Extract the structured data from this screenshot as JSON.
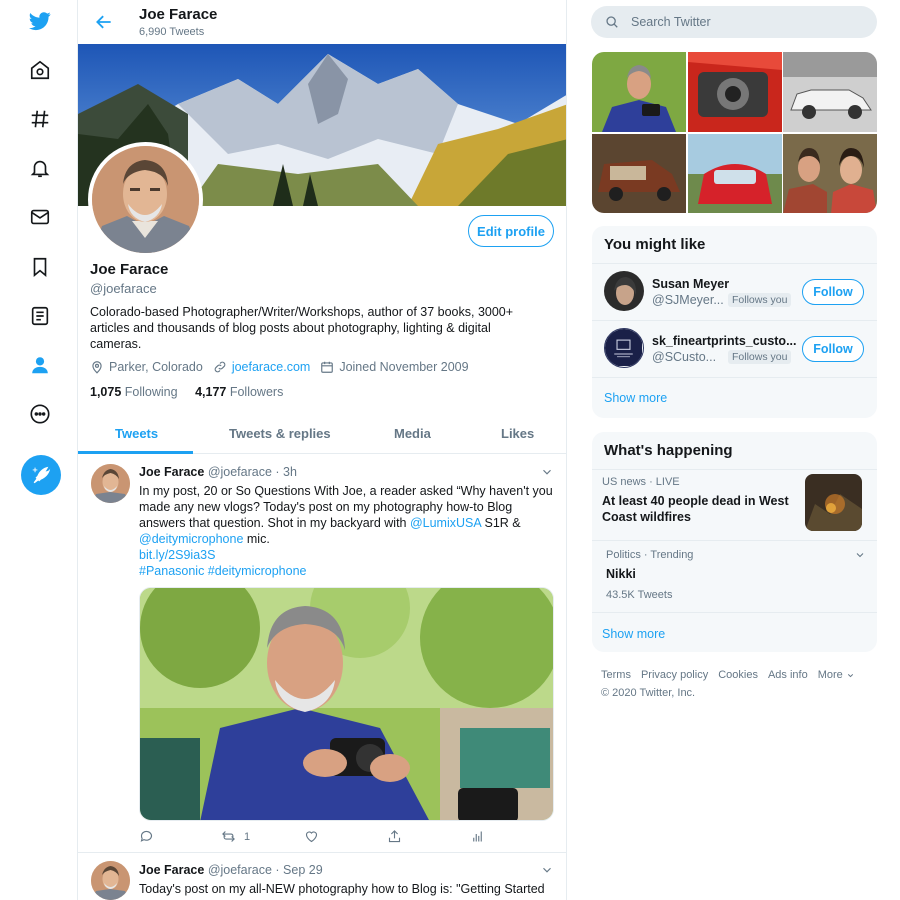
{
  "colors": {
    "accent": "#1da1f2",
    "text": "#14171a",
    "muted": "#657786",
    "border": "#e6ecf0",
    "panel": "#f5f8fa"
  },
  "nav": {
    "items": [
      {
        "icon": "twitter-logo-icon"
      },
      {
        "icon": "home-icon"
      },
      {
        "icon": "explore-hashtag-icon"
      },
      {
        "icon": "notifications-bell-icon"
      },
      {
        "icon": "messages-envelope-icon"
      },
      {
        "icon": "bookmarks-icon"
      },
      {
        "icon": "lists-icon"
      },
      {
        "icon": "profile-icon"
      },
      {
        "icon": "more-icon"
      }
    ],
    "compose_icon": "compose-tweet-icon"
  },
  "header": {
    "name": "Joe Farace",
    "tweet_count": "6,990 Tweets"
  },
  "profile": {
    "edit_label": "Edit profile",
    "name": "Joe Farace",
    "handle": "@joefarace",
    "bio": "Colorado-based Photographer/Writer/Workshops, author of 37 books, 3000+ articles and thousands of blog posts about photography, lighting & digital cameras.",
    "location": "Parker, Colorado",
    "website": "joefarace.com",
    "joined": "Joined November 2009",
    "following_count": "1,075",
    "following_label": "Following",
    "followers_count": "4,177",
    "followers_label": "Followers"
  },
  "tabs": [
    {
      "label": "Tweets",
      "active": true
    },
    {
      "label": "Tweets & replies",
      "active": false
    },
    {
      "label": "Media",
      "active": false
    },
    {
      "label": "Likes",
      "active": false
    }
  ],
  "tweets": [
    {
      "name": "Joe Farace",
      "handle": "@joefarace",
      "time": "· 3h",
      "text_1": "In my post, 20 or So Questions With Joe, a reader asked “Why haven't you made any new vlogs? Today's post on my photography how-to Blog answers that question. Shot in my backyard with ",
      "mention_1": "@LumixUSA",
      "text_2": " S1R & ",
      "mention_2": "@deitymicrophone",
      "text_3": " mic.",
      "link": "bit.ly/2S9ia3S",
      "hashtags": "#Panasonic #deitymicrophone",
      "retweets": "1"
    },
    {
      "name": "Joe Farace",
      "handle": "@joefarace",
      "time": "· Sep 29",
      "text": "Today's post on my all-NEW photography how to Blog is: \"Getting Started"
    }
  ],
  "search": {
    "placeholder": "Search Twitter"
  },
  "you_might_like": {
    "title": "You might like",
    "accounts": [
      {
        "name": "Susan Meyer",
        "handle": "@SJMeyer...",
        "badge": "Follows you",
        "button": "Follow"
      },
      {
        "name": "sk_fineartprints_custo...",
        "handle": "@SCusto...",
        "badge": "Follows you",
        "button": "Follow"
      }
    ],
    "show_more": "Show more"
  },
  "whats_happening": {
    "title": "What's happening",
    "trends": [
      {
        "meta": "US news · LIVE",
        "title": "At least 40 people dead in West Coast wildfires"
      },
      {
        "meta": "Politics · Trending",
        "title": "Nikki",
        "count": "43.5K Tweets"
      }
    ],
    "show_more": "Show more"
  },
  "footer": {
    "links": [
      "Terms",
      "Privacy policy",
      "Cookies",
      "Ads info",
      "More"
    ],
    "copyright": "© 2020 Twitter, Inc."
  }
}
